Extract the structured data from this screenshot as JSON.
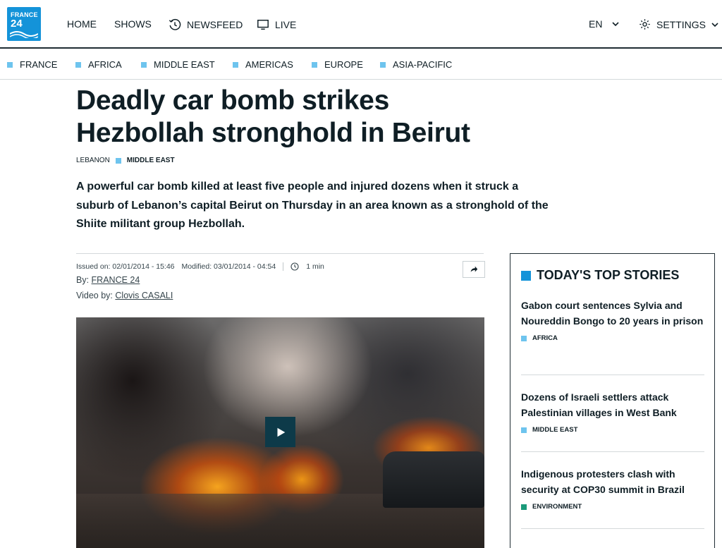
{
  "header": {
    "logo": {
      "line1": "FRANCE",
      "line2": "24"
    },
    "nav": [
      {
        "label": "HOME",
        "icon": ""
      },
      {
        "label": "SHOWS",
        "icon": ""
      },
      {
        "label": "NEWSFEED",
        "icon": "history-icon"
      },
      {
        "label": "LIVE",
        "icon": "tv-icon"
      }
    ],
    "language": "EN",
    "settings_label": "SETTINGS"
  },
  "regions": [
    "FRANCE",
    "AFRICA",
    "MIDDLE EAST",
    "AMERICAS",
    "EUROPE",
    "ASIA-PACIFIC"
  ],
  "article": {
    "title_line1": "Deadly car bomb strikes",
    "title_line2": "Hezbollah stronghold in Beirut",
    "tag1": "LEBANON",
    "tag2": "MIDDLE EAST",
    "lede": "A powerful car bomb killed at least five people and injured dozens when it struck a suburb of Lebanon’s capital Beirut on Thursday in an area known as a stronghold of the Shiite militant group Hezbollah.",
    "issued": "Issued on: 02/01/2014 - 15:46",
    "modified": "Modified: 03/01/2014 - 04:54",
    "read_time": "1 min",
    "by_label": "By:",
    "by_author": "FRANCE 24",
    "video_label": "Video by:",
    "video_author": "Clovis CASALI"
  },
  "sidebar": {
    "title": "TODAY'S TOP STORIES",
    "stories": [
      {
        "title": "Gabon court sentences Sylvia and Noureddin Bongo to 20 years in prison",
        "category": "AFRICA",
        "color": "#6ec4ee"
      },
      {
        "title": "Dozens of Israeli settlers attack Palestinian villages in West Bank",
        "category": "MIDDLE EAST",
        "color": "#6ec4ee"
      },
      {
        "title": "Indigenous protesters clash with security at COP30 summit in Brazil",
        "category": "ENVIRONMENT",
        "color": "#1b9a7a"
      }
    ]
  },
  "colors": {
    "brand": "#1493d9",
    "region_square": "#6ec4ee",
    "dark": "#0f1e25",
    "play_button": "#0d3a49"
  }
}
